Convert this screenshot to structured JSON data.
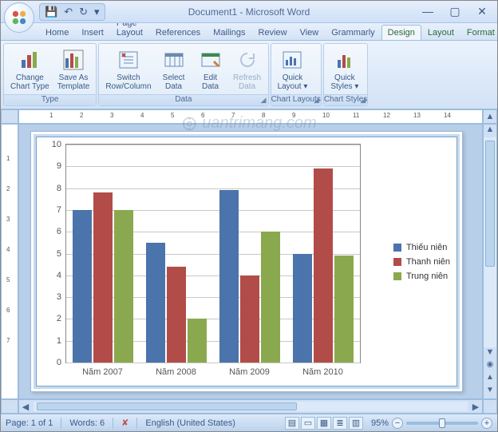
{
  "titlebar": {
    "title": "Document1 - Microsoft Word"
  },
  "qat": {
    "save": "💾",
    "undo": "↶",
    "redo": "↻"
  },
  "wincontrols": {
    "min": "—",
    "max": "▢",
    "close": "✕"
  },
  "tabs": [
    {
      "label": "Home"
    },
    {
      "label": "Insert"
    },
    {
      "label": "Page Layout"
    },
    {
      "label": "References"
    },
    {
      "label": "Mailings"
    },
    {
      "label": "Review"
    },
    {
      "label": "View"
    },
    {
      "label": "Grammarly"
    },
    {
      "label": "Design",
      "context": true,
      "active": true
    },
    {
      "label": "Layout",
      "context": true
    },
    {
      "label": "Format",
      "context": true
    }
  ],
  "help": "?",
  "ribbon": {
    "groups": [
      {
        "label": "Type",
        "buttons": [
          {
            "name": "change-chart-type-button",
            "label": "Change\nChart Type",
            "icon": "bar-chart-icon"
          },
          {
            "name": "save-as-template-button",
            "label": "Save As\nTemplate",
            "icon": "template-icon"
          }
        ]
      },
      {
        "label": "Data",
        "buttons": [
          {
            "name": "switch-row-column-button",
            "label": "Switch\nRow/Column",
            "icon": "switch-icon"
          },
          {
            "name": "select-data-button",
            "label": "Select\nData",
            "icon": "select-data-icon"
          },
          {
            "name": "edit-data-button",
            "label": "Edit\nData",
            "icon": "edit-data-icon"
          },
          {
            "name": "refresh-data-button",
            "label": "Refresh\nData",
            "icon": "refresh-icon",
            "disabled": true
          }
        ],
        "corner": true
      },
      {
        "label": "Chart Layouts",
        "buttons": [
          {
            "name": "quick-layout-button",
            "label": "Quick\nLayout ▾",
            "icon": "quick-layout-icon"
          }
        ],
        "corner": true
      },
      {
        "label": "Chart Styles",
        "buttons": [
          {
            "name": "quick-styles-button",
            "label": "Quick\nStyles ▾",
            "icon": "quick-styles-icon"
          }
        ],
        "corner": true
      }
    ]
  },
  "ruler": {
    "hticks": [
      "",
      "1",
      "2",
      "3",
      "4",
      "5",
      "6",
      "7",
      "8",
      "9",
      "10",
      "11",
      "12",
      "13",
      "14"
    ],
    "vticks": [
      "",
      "1",
      "2",
      "3",
      "4",
      "5",
      "6",
      "7"
    ]
  },
  "chart_data": {
    "type": "bar",
    "categories": [
      "Năm 2007",
      "Năm 2008",
      "Năm 2009",
      "Năm 2010"
    ],
    "series": [
      {
        "name": "Thiếu niên",
        "color": "#4a74ab",
        "values": [
          7.0,
          5.5,
          7.9,
          5.0
        ]
      },
      {
        "name": "Thanh niên",
        "color": "#b24c49",
        "values": [
          7.8,
          4.4,
          4.0,
          8.9
        ]
      },
      {
        "name": "Trung niên",
        "color": "#8aa94f",
        "values": [
          7.0,
          2.0,
          6.0,
          4.9
        ]
      }
    ],
    "ylim": [
      0,
      10
    ],
    "yticks": [
      0,
      1,
      2,
      3,
      4,
      5,
      6,
      7,
      8,
      9,
      10
    ],
    "title": "",
    "xlabel": "",
    "ylabel": ""
  },
  "statusbar": {
    "page": "Page: 1 of 1",
    "words": "Words: 6",
    "lang": "English (United States)",
    "zoom": "95%"
  },
  "watermark": "uantrimang.com"
}
